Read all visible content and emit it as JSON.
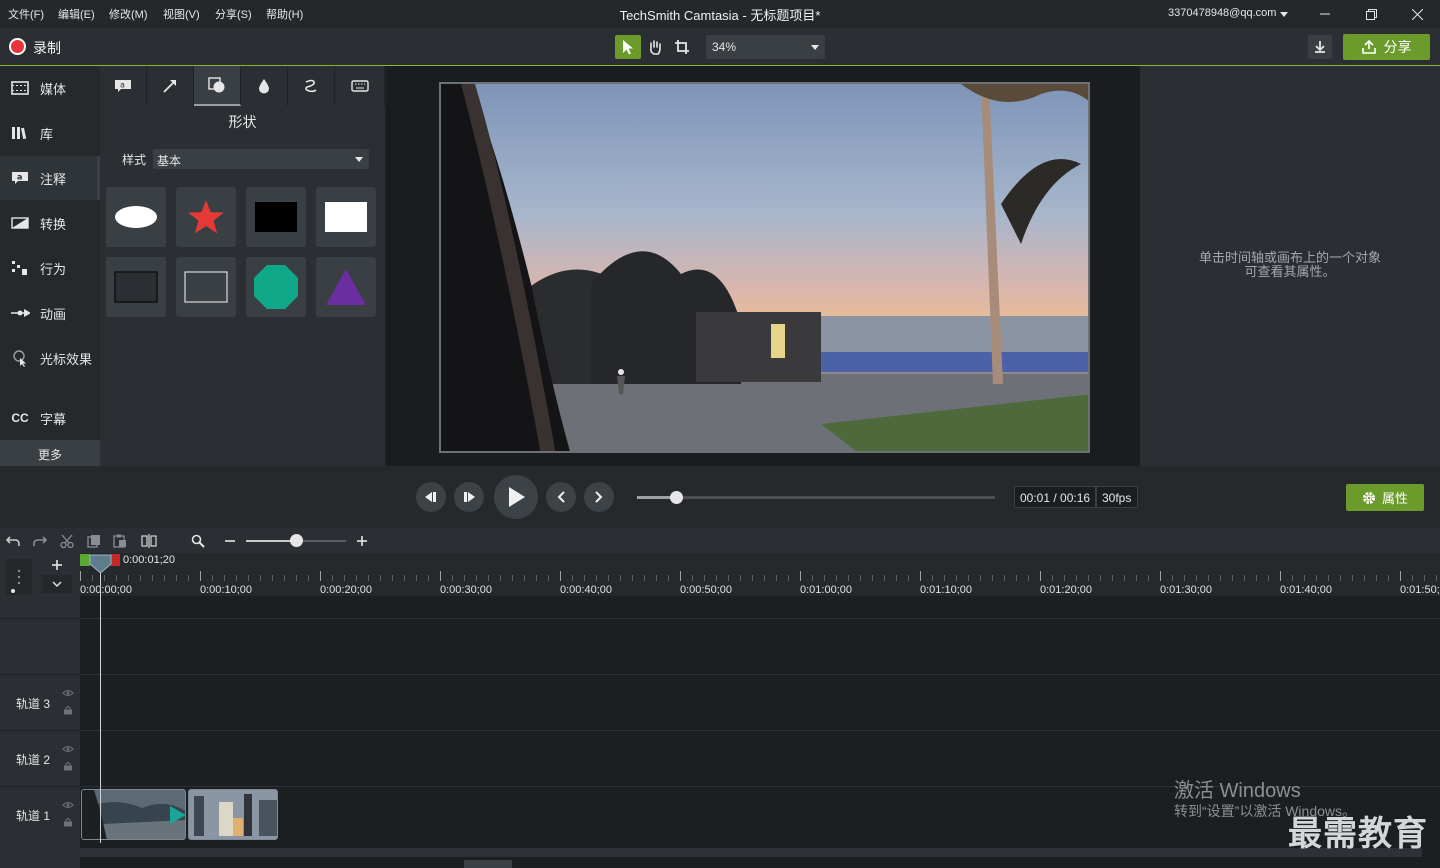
{
  "menu": [
    "文件(F)",
    "编辑(E)",
    "修改(M)",
    "视图(V)",
    "分享(S)",
    "帮助(H)"
  ],
  "app_title": "TechSmith Camtasia - 无标题项目*",
  "account": "3370478948@qq.com",
  "toolbar": {
    "record_label": "录制",
    "zoom": "34%",
    "share_label": "分享"
  },
  "nav": {
    "items": [
      {
        "label": "媒体",
        "icon": "film-strip-icon"
      },
      {
        "label": "库",
        "icon": "library-books-icon"
      },
      {
        "label": "注释",
        "icon": "annotation-callout-icon"
      },
      {
        "label": "转换",
        "icon": "transition-icon"
      },
      {
        "label": "行为",
        "icon": "behavior-icon"
      },
      {
        "label": "动画",
        "icon": "animation-arrow-icon"
      },
      {
        "label": "光标效果",
        "icon": "cursor-effect-icon"
      },
      {
        "label": "字幕",
        "icon": "cc-captions-icon"
      }
    ],
    "more": "更多"
  },
  "annotation_panel": {
    "title": "形状",
    "style_label": "样式",
    "style_value": "基本",
    "tabs": [
      "callout-tab-icon",
      "arrow-tab-icon",
      "shape-tab-icon",
      "blur-tab-icon",
      "sketch-motion-tab-icon",
      "keystroke-tab-icon"
    ]
  },
  "properties": {
    "hint_line1": "单击时间轴或画布上的一个对象",
    "hint_line2": "可查看其属性。",
    "button_label": "属性"
  },
  "playback": {
    "time": "00:01 / 00:16",
    "fps": "30fps",
    "progress": 0.11
  },
  "timeline": {
    "playhead_time": "0:00:01;20",
    "ruler": [
      "0:00:00;00",
      "0:00:10;00",
      "0:00:20;00",
      "0:00:30;00",
      "0:00:40;00",
      "0:00:50;00",
      "0:01:00;00",
      "0:01:10;00",
      "0:01:20;00",
      "0:01:30;00",
      "0:01:40;00",
      "0:01:50;"
    ],
    "tracks": [
      "轨道 3",
      "轨道 2",
      "轨道 1"
    ],
    "zoom_level": 0.5
  },
  "watermark": {
    "line1": "激活 Windows",
    "line2": "转到“设置”以激活 Windows。",
    "brand": "最需教育"
  },
  "colors": {
    "accent": "#6b9b2a",
    "record": "#e8333a",
    "star": "#e53935",
    "octagon": "#0fa98a",
    "triangle": "#6a2ea0"
  }
}
